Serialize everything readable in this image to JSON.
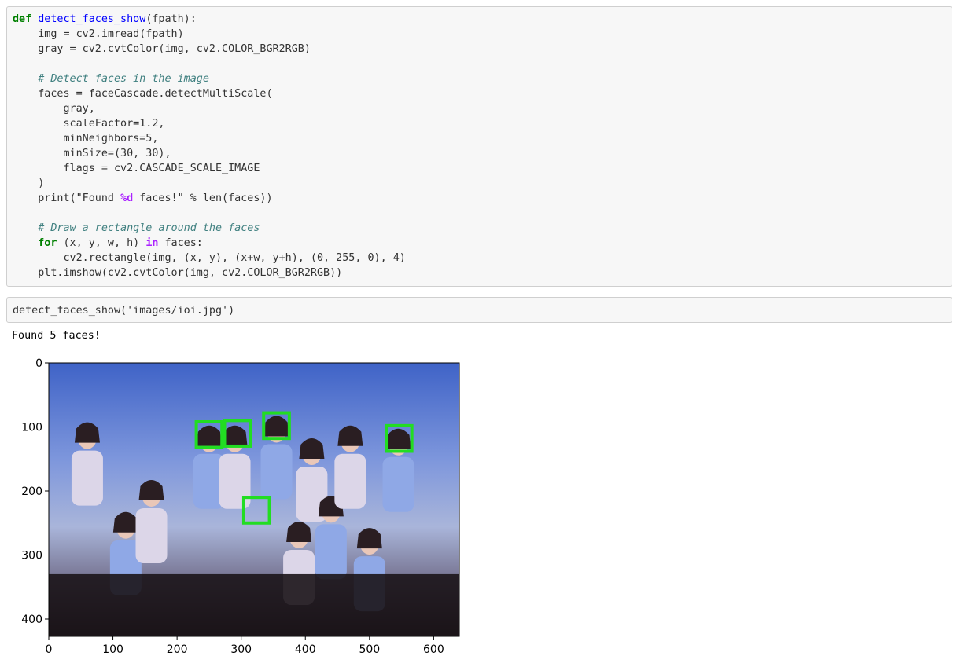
{
  "cell1": {
    "lines": [
      [
        {
          "c": "kw",
          "t": "def"
        },
        {
          "t": " "
        },
        {
          "c": "fn",
          "t": "detect_faces_show"
        },
        {
          "t": "(fpath):"
        }
      ],
      [
        {
          "t": "    img = cv2.imread(fpath)"
        }
      ],
      [
        {
          "t": "    gray = cv2.cvtColor(img, cv2.COLOR_BGR2RGB)"
        }
      ],
      [
        {
          "t": ""
        }
      ],
      [
        {
          "t": "    "
        },
        {
          "c": "cm",
          "t": "# Detect faces in the image"
        }
      ],
      [
        {
          "t": "    faces = faceCascade.detectMultiScale("
        }
      ],
      [
        {
          "t": "        gray,"
        }
      ],
      [
        {
          "t": "        scaleFactor=1.2,"
        }
      ],
      [
        {
          "t": "        minNeighbors=5,"
        }
      ],
      [
        {
          "t": "        minSize=(30, 30),"
        }
      ],
      [
        {
          "t": "        flags = cv2.CASCADE_SCALE_IMAGE"
        }
      ],
      [
        {
          "t": "    )"
        }
      ],
      [
        {
          "t": "    print(\"Found "
        },
        {
          "c": "op-in",
          "t": "%d"
        },
        {
          "t": " faces!\" % len(faces))"
        }
      ],
      [
        {
          "t": ""
        }
      ],
      [
        {
          "t": "    "
        },
        {
          "c": "cm",
          "t": "# Draw a rectangle around the faces"
        }
      ],
      [
        {
          "t": "    "
        },
        {
          "c": "kw",
          "t": "for"
        },
        {
          "t": " (x, y, w, h) "
        },
        {
          "c": "op-in",
          "t": "in"
        },
        {
          "t": " faces:"
        }
      ],
      [
        {
          "t": "        cv2.rectangle(img, (x, y), (x+w, y+h), (0, 255, 0), 4)"
        }
      ],
      [
        {
          "t": "    plt.imshow(cv2.cvtColor(img, cv2.COLOR_BGR2RGB))"
        }
      ]
    ]
  },
  "cell2": {
    "code": "detect_faces_show('images/ioi.jpg')"
  },
  "output": {
    "text": "Found 5 faces!"
  },
  "plot": {
    "x_ticks": [
      0,
      100,
      200,
      300,
      400,
      500,
      600
    ],
    "y_ticks": [
      0,
      100,
      200,
      300,
      400
    ],
    "x_range": [
      0,
      640
    ],
    "y_range": [
      0,
      427
    ],
    "face_box_color": "#22dd22",
    "faces": [
      {
        "x": 230,
        "y": 92,
        "w": 40,
        "h": 40
      },
      {
        "x": 274,
        "y": 90,
        "w": 40,
        "h": 40
      },
      {
        "x": 335,
        "y": 78,
        "w": 40,
        "h": 40
      },
      {
        "x": 526,
        "y": 98,
        "w": 40,
        "h": 40
      },
      {
        "x": 304,
        "y": 210,
        "w": 40,
        "h": 40
      }
    ]
  }
}
